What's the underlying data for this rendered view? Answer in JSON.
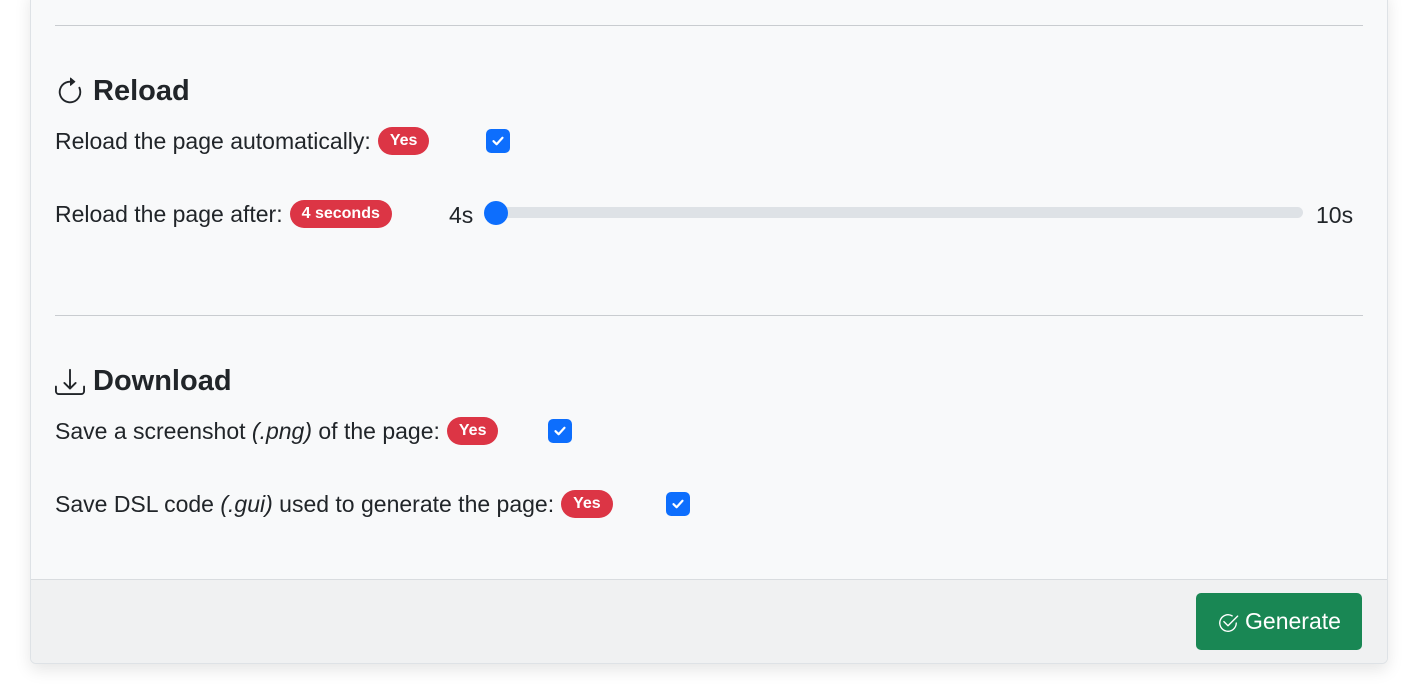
{
  "reload": {
    "title": "Reload",
    "icon": "arrow-clockwise-icon",
    "auto_label": "Reload the page automatically:",
    "auto_badge": "Yes",
    "auto_checked": true,
    "after_label": "Reload the page after:",
    "after_badge": "4 seconds",
    "range_min_label": "4s",
    "range_max_label": "10s",
    "range_value": 4,
    "range_min": 4,
    "range_max": 10
  },
  "download": {
    "title": "Download",
    "icon": "download-icon",
    "screenshot_label_pre": "Save a screenshot ",
    "screenshot_label_em": "(.png)",
    "screenshot_label_post": " of the page:",
    "screenshot_badge": "Yes",
    "screenshot_checked": true,
    "dsl_label_pre": "Save DSL code ",
    "dsl_label_em": "(.gui)",
    "dsl_label_post": " used to generate the page:",
    "dsl_badge": "Yes",
    "dsl_checked": true
  },
  "footer": {
    "generate_label": "Generate",
    "generate_icon": "check-circle-icon"
  },
  "colors": {
    "primary": "#0d6efd",
    "danger": "#dc3545",
    "success": "#198754"
  }
}
